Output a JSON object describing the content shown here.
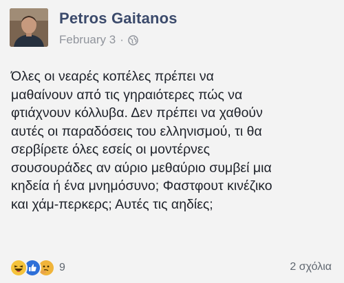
{
  "post": {
    "author": "Petros Gaitanos",
    "date": "February 3",
    "separator": "·",
    "privacy_icon": "globe-icon",
    "text_lines": [
      "Όλες οι νεαρές κοπέλες πρέπει να",
      "μαθαίνουν από τις γηραιότερες πώς να",
      "φτιάχνουν κόλλυβα. Δεν πρέπει να χαθούν",
      "αυτές οι παραδόσεις του ελληνισμού, τι θα",
      "σερβίρετε όλες εσείς οι μοντέρνες",
      "σουσουράδες αν αύριο μεθαύριο συμβεί μια",
      "κηδεία ή ένα μνημόσυνο; Φαστφουτ κινέζικο",
      "και χάμ-περκερς; Αυτές τις αηδίες;"
    ]
  },
  "footer": {
    "reactions": [
      "haha-icon",
      "like-icon",
      "thinking-icon"
    ],
    "reaction_count": "9",
    "comments": "2 σχόλια"
  },
  "colors": {
    "author": "#3b4a6b",
    "meta": "#90949c",
    "like": "#2d6fd8",
    "haha": "#f5c33b"
  }
}
